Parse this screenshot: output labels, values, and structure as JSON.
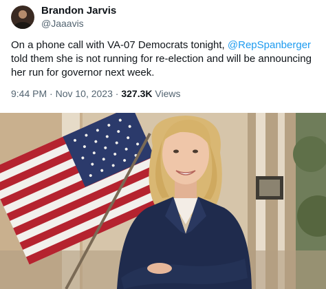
{
  "author": {
    "display_name": "Brandon Jarvis",
    "handle": "@Jaaavis"
  },
  "tweet": {
    "text_before": "On a phone call with VA-07 Democrats tonight, ",
    "mention": "@RepSpanberger",
    "text_after": " told them she is not running for re-election and will be announcing her run for governor next week."
  },
  "meta": {
    "time": "9:44 PM",
    "separator": " · ",
    "date": "Nov 10, 2023",
    "views_count": "327.3K",
    "views_label": " Views"
  },
  "colors": {
    "text": "#0f1419",
    "secondary": "#536471",
    "link": "#1d9bf0"
  },
  "icons": {
    "avatar": "avatar-photo"
  }
}
